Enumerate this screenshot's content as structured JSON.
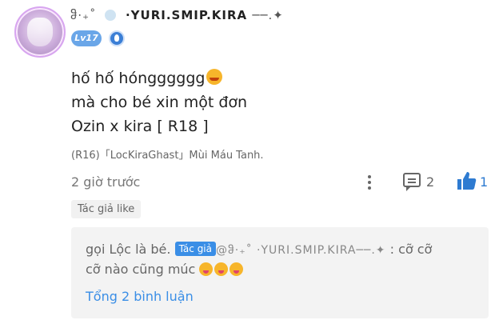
{
  "user": {
    "name_prefix": "ჵ⋅₊˚",
    "name": "·YURI.SMIP.KIRA",
    "name_suffix": "──.✦",
    "level": "Lv17"
  },
  "comment": {
    "line1": "hố hố hóngggggg",
    "line2": "mà cho bé xin một đơn",
    "line3": "Ozin x kira [ R18 ]",
    "reference": "(R16)「LocKiraGhast」Mùi Máu Tanh.",
    "time": "2 giờ trước",
    "reply_count": "2",
    "like_count": "1",
    "author_liked_label": "Tác giả like"
  },
  "reply": {
    "author": "gọi Lộc là bé.",
    "tag": "Tác giả",
    "mention": "@ჵ⋅₊˚ ·YURI.SMIP.KIRA──.✦",
    "text_after_mention": " : cỡ cỡ",
    "line2": "cỡ nào cũng múc",
    "total_label": "Tổng 2 bình luận"
  },
  "colors": {
    "accent": "#3a8ee6",
    "level_badge": "#6aa6e8",
    "reply_bg": "#f3f3f3"
  },
  "icons": [
    "more-vertical-icon",
    "comment-icon",
    "thumbs-up-icon",
    "verified-badge-icon"
  ]
}
